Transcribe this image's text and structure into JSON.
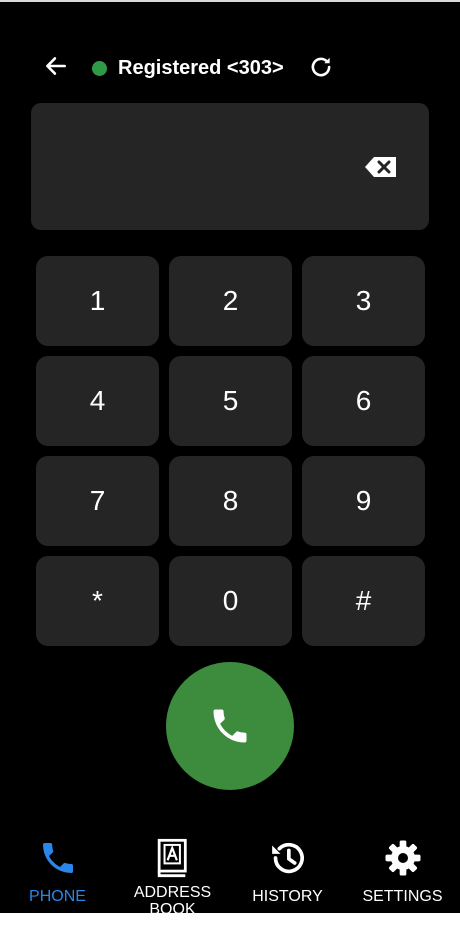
{
  "header": {
    "status_text": "Registered <303>",
    "status_color": "#2e9a47",
    "icons": [
      "arrow-left-icon",
      "refresh-icon"
    ]
  },
  "display": {
    "value": "",
    "backspace_icon": "backspace-icon"
  },
  "keypad": {
    "keys": [
      "1",
      "2",
      "3",
      "4",
      "5",
      "6",
      "7",
      "8",
      "9",
      "*",
      "0",
      "#"
    ]
  },
  "call": {
    "icon": "phone-icon",
    "color": "#3d8b3d"
  },
  "nav": {
    "items": [
      {
        "label": "PHONE",
        "icon": "phone-icon",
        "active": true
      },
      {
        "label": "ADDRESS BOOK",
        "icon": "address-book-icon",
        "active": false
      },
      {
        "label": "HISTORY",
        "icon": "history-icon",
        "active": false
      },
      {
        "label": "SETTINGS",
        "icon": "gear-icon",
        "active": false
      }
    ],
    "active_color": "#2a86e8"
  }
}
